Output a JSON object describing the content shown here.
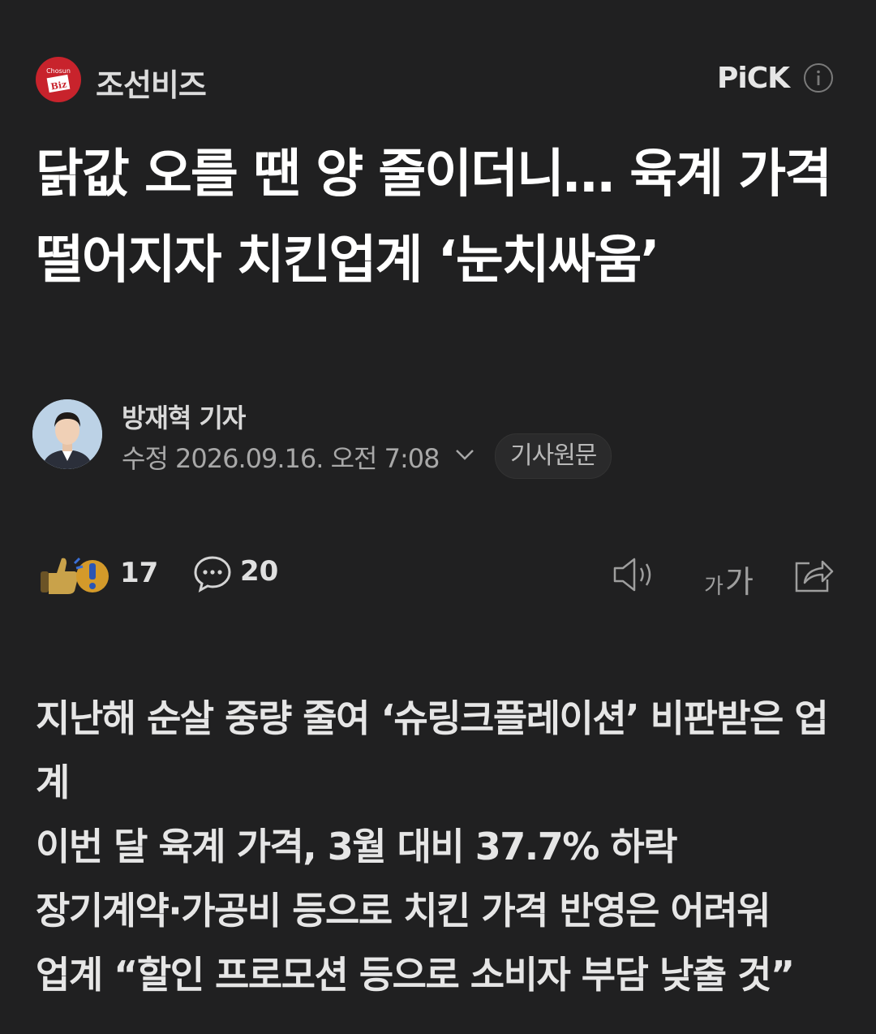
{
  "press": {
    "logo_text_top": "Chosun",
    "logo_text_bottom": "Biz",
    "name": "조선비즈",
    "brand_color": "#c8232c"
  },
  "pick_label": "PiCK",
  "article": {
    "headline": "닭값 오를 땐 양 줄이더니… 육계 가격 떨어지자 치킨업계 ‘눈치싸움’",
    "author": "방재혁 기자",
    "meta": "수정 2026.09.16. 오전 7:08",
    "original_button": "기사원문"
  },
  "actions": {
    "reaction_count": "17",
    "comment_count": "20",
    "font_small": "가",
    "font_large": "가"
  },
  "icons": {
    "info": "info-icon",
    "reaction": "reaction-icon",
    "comment": "comment-icon",
    "speaker": "speaker-icon",
    "share": "share-icon",
    "chevron": "chevron-down-icon"
  },
  "summary": [
    "지난해 순살 중량 줄여 ‘슈링크플레이션’ 비판받은 업계",
    "이번 달 육계 가격, 3월 대비 37.7% 하락",
    "장기계약·가공비 등으로 치킨 가격 반영은 어려워",
    "업계 “할인 프로모션 등으로 소비자 부담 낮출 것”"
  ],
  "colors": {
    "background": "#202021",
    "text_primary": "#ffffff",
    "text_secondary": "#a8a8a8"
  }
}
